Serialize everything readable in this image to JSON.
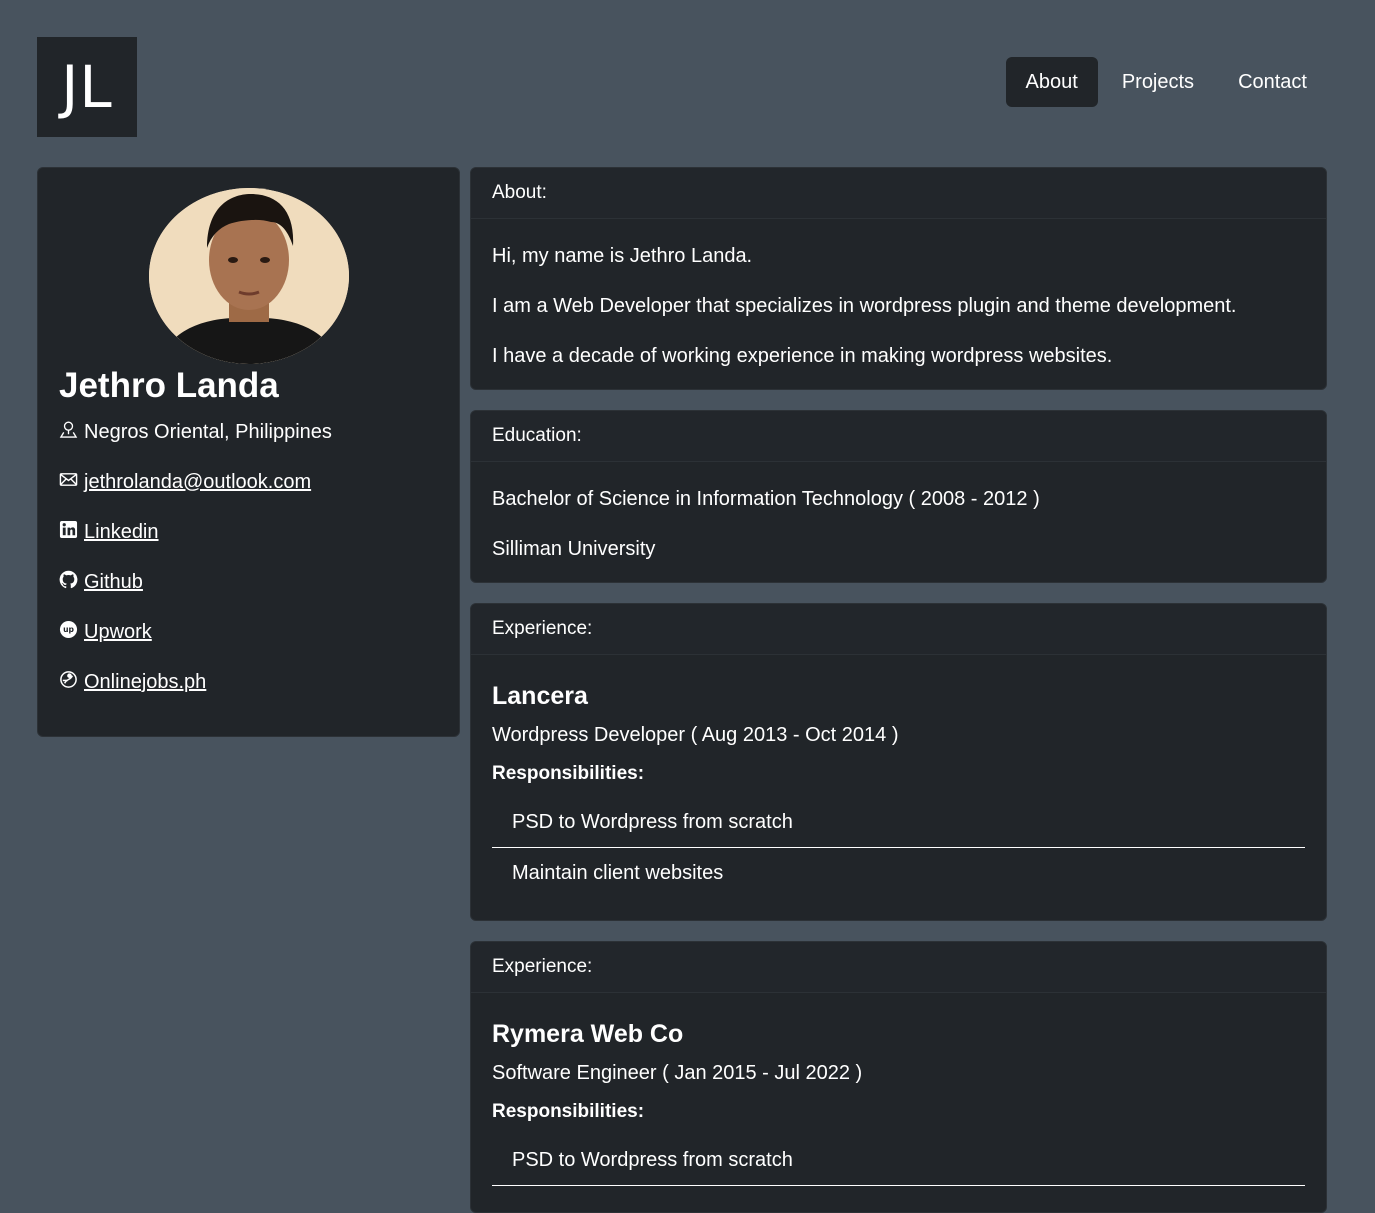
{
  "logo": {
    "text": "JL"
  },
  "nav": {
    "items": [
      {
        "label": "About",
        "active": true
      },
      {
        "label": "Projects",
        "active": false
      },
      {
        "label": "Contact",
        "active": false
      }
    ]
  },
  "profile": {
    "name": "Jethro Landa",
    "location": "Negros Oriental, Philippines",
    "email": "jethrolanda@outlook.com",
    "links": {
      "linkedin": "Linkedin",
      "github": "Github",
      "upwork": "Upwork",
      "onlinejobs": "Onlinejobs.ph"
    }
  },
  "about": {
    "heading": "About:",
    "paragraphs": [
      "Hi, my name is Jethro Landa.",
      "I am a Web Developer that specializes in wordpress plugin and theme development.",
      "I have a decade of working experience in making wordpress websites."
    ]
  },
  "education": {
    "heading": "Education:",
    "degree": "Bachelor of Science in Information Technology ( 2008 - 2012 )",
    "school": "Silliman University"
  },
  "experience": [
    {
      "heading": "Experience:",
      "company": "Lancera",
      "role": "Wordpress Developer ( Aug 2013 - Oct 2014 )",
      "resp_label": "Responsibilities:",
      "responsibilities": [
        "PSD to Wordpress from scratch",
        "Maintain client websites"
      ]
    },
    {
      "heading": "Experience:",
      "company": "Rymera Web Co",
      "role": "Software Engineer ( Jan 2015 - Jul 2022 )",
      "resp_label": "Responsibilities:",
      "responsibilities": [
        "PSD to Wordpress from scratch"
      ]
    }
  ],
  "colors": {
    "background": "#48535e",
    "card": "#212529",
    "text": "#ffffff"
  }
}
